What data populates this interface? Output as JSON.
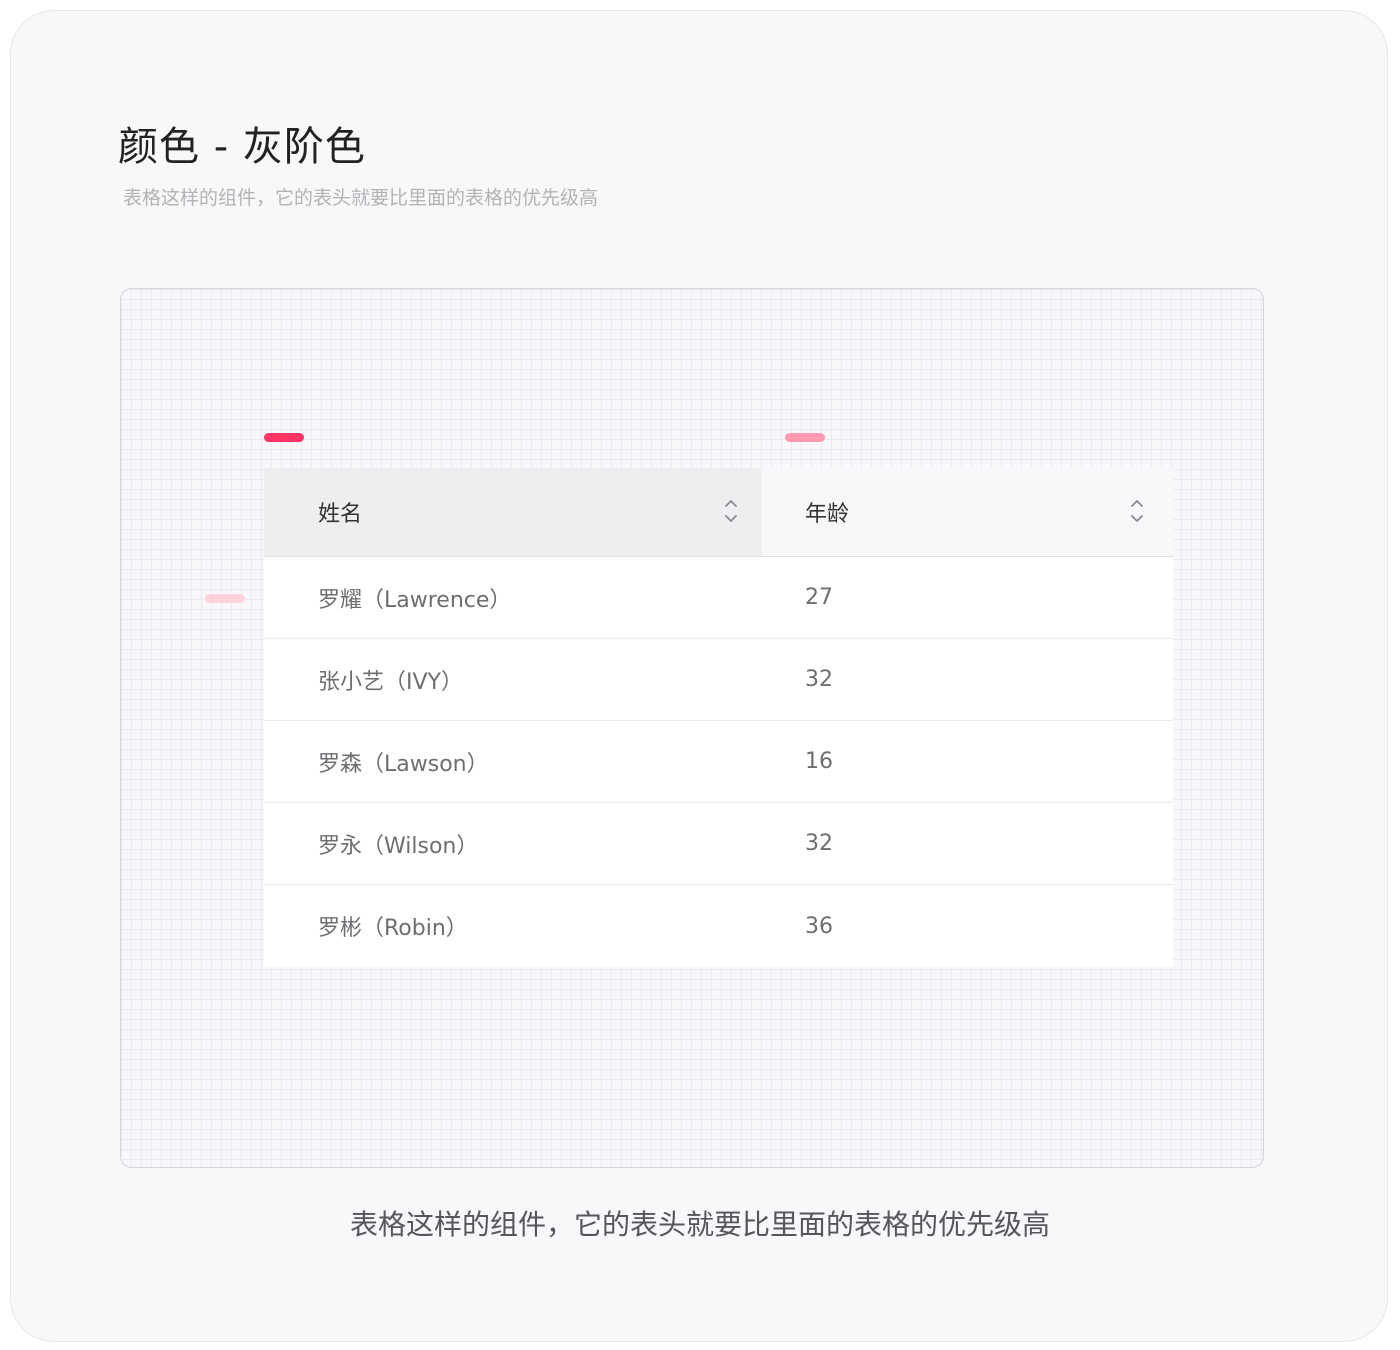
{
  "header": {
    "title": "颜色 - 灰阶色",
    "subtitle": "表格这样的组件，它的表头就要比里面的表格的优先级高"
  },
  "markers": {
    "primary_color": "#ff3366",
    "secondary_color": "#ff99b0",
    "tertiary_color": "#ffd2dc"
  },
  "table": {
    "header_colors": {
      "name_column_bg": "#eeeef0",
      "age_column_bg": "#f8f8fa"
    },
    "columns": [
      {
        "label": "姓名",
        "sort_icon": "sort-icon"
      },
      {
        "label": "年龄",
        "sort_icon": "sort-icon"
      }
    ],
    "rows": [
      {
        "name": "罗耀（Lawrence）",
        "age": "27"
      },
      {
        "name": "张小艺（IVY）",
        "age": "32"
      },
      {
        "name": "罗森（Lawson）",
        "age": "16"
      },
      {
        "name": "罗永（Wilson）",
        "age": "32"
      },
      {
        "name": "罗彬（Robin）",
        "age": "36"
      }
    ]
  },
  "footer": {
    "caption": "表格这样的组件，它的表头就要比里面的表格的优先级高"
  }
}
